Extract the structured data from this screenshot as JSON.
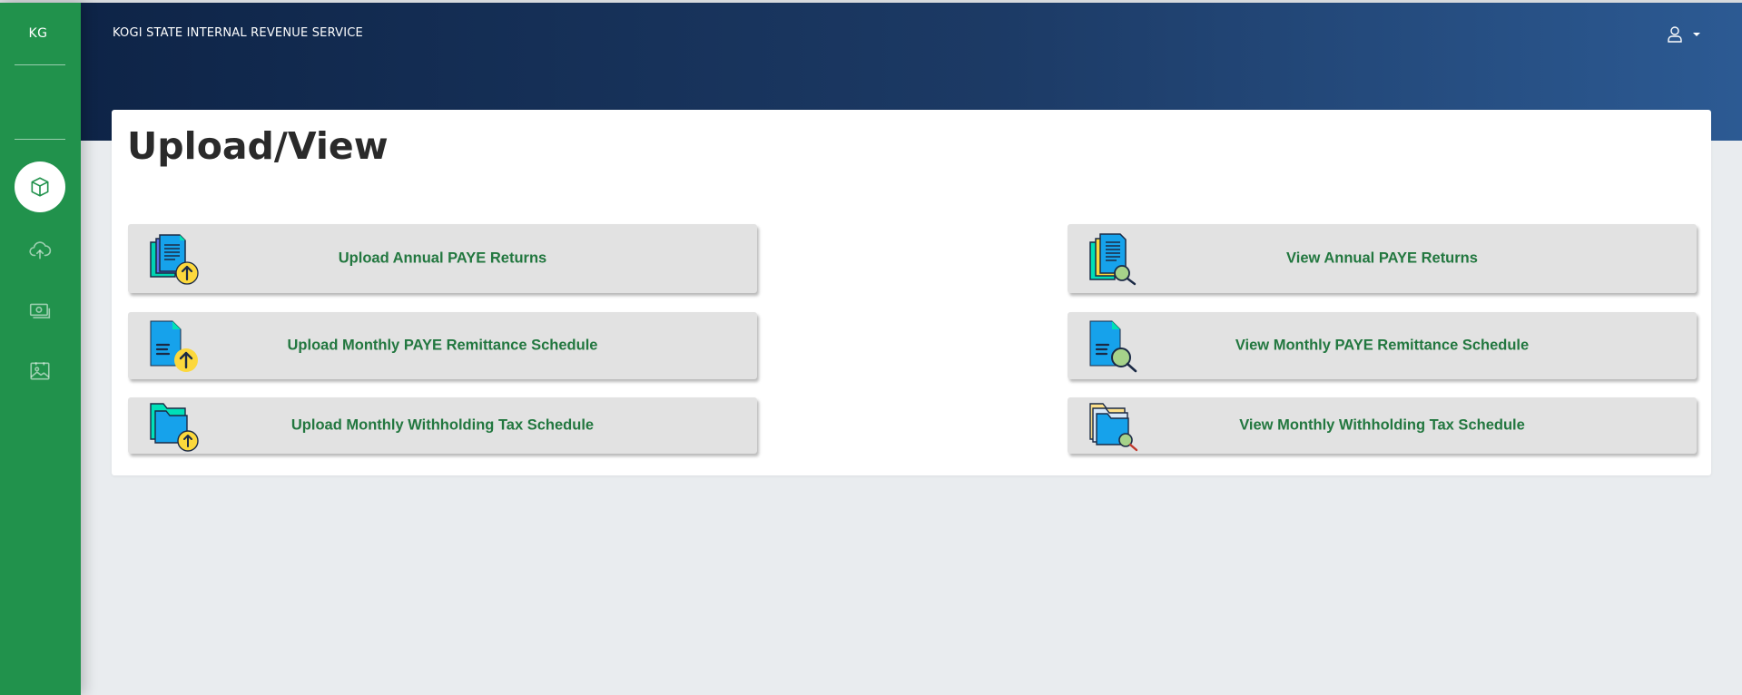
{
  "sidebar": {
    "brand": "KG",
    "items": [
      {
        "icon": "box-icon",
        "active": true
      },
      {
        "icon": "cloud-upload-icon",
        "active": false
      },
      {
        "icon": "money-icon",
        "active": false
      },
      {
        "icon": "image-icon",
        "active": false
      }
    ]
  },
  "header": {
    "title": "KOGI STATE INTERNAL REVENUE SERVICE",
    "user_icon": "user-icon",
    "caret_icon": "caret-down-icon"
  },
  "main": {
    "title": "Upload/View",
    "tiles": [
      {
        "label": "Upload Annual PAYE Returns",
        "icon": "upload-documents-icon"
      },
      {
        "label": "View Annual PAYE Returns",
        "icon": "view-documents-icon"
      },
      {
        "label": "Upload Monthly PAYE Remittance Schedule",
        "icon": "upload-document-icon"
      },
      {
        "label": "View Monthly PAYE Remittance Schedule",
        "icon": "view-document-icon"
      },
      {
        "label": "Upload Monthly Withholding Tax Schedule",
        "icon": "upload-folder-icon"
      },
      {
        "label": "View Monthly Withholding Tax Schedule",
        "icon": "view-folder-icon"
      }
    ]
  },
  "colors": {
    "sidebar": "#21924c",
    "header_start": "#0e2447",
    "header_end": "#2c5a93",
    "tile_text": "#22773f",
    "tile_bg": "#e2e2e2",
    "page_bg": "#e9ecef"
  }
}
